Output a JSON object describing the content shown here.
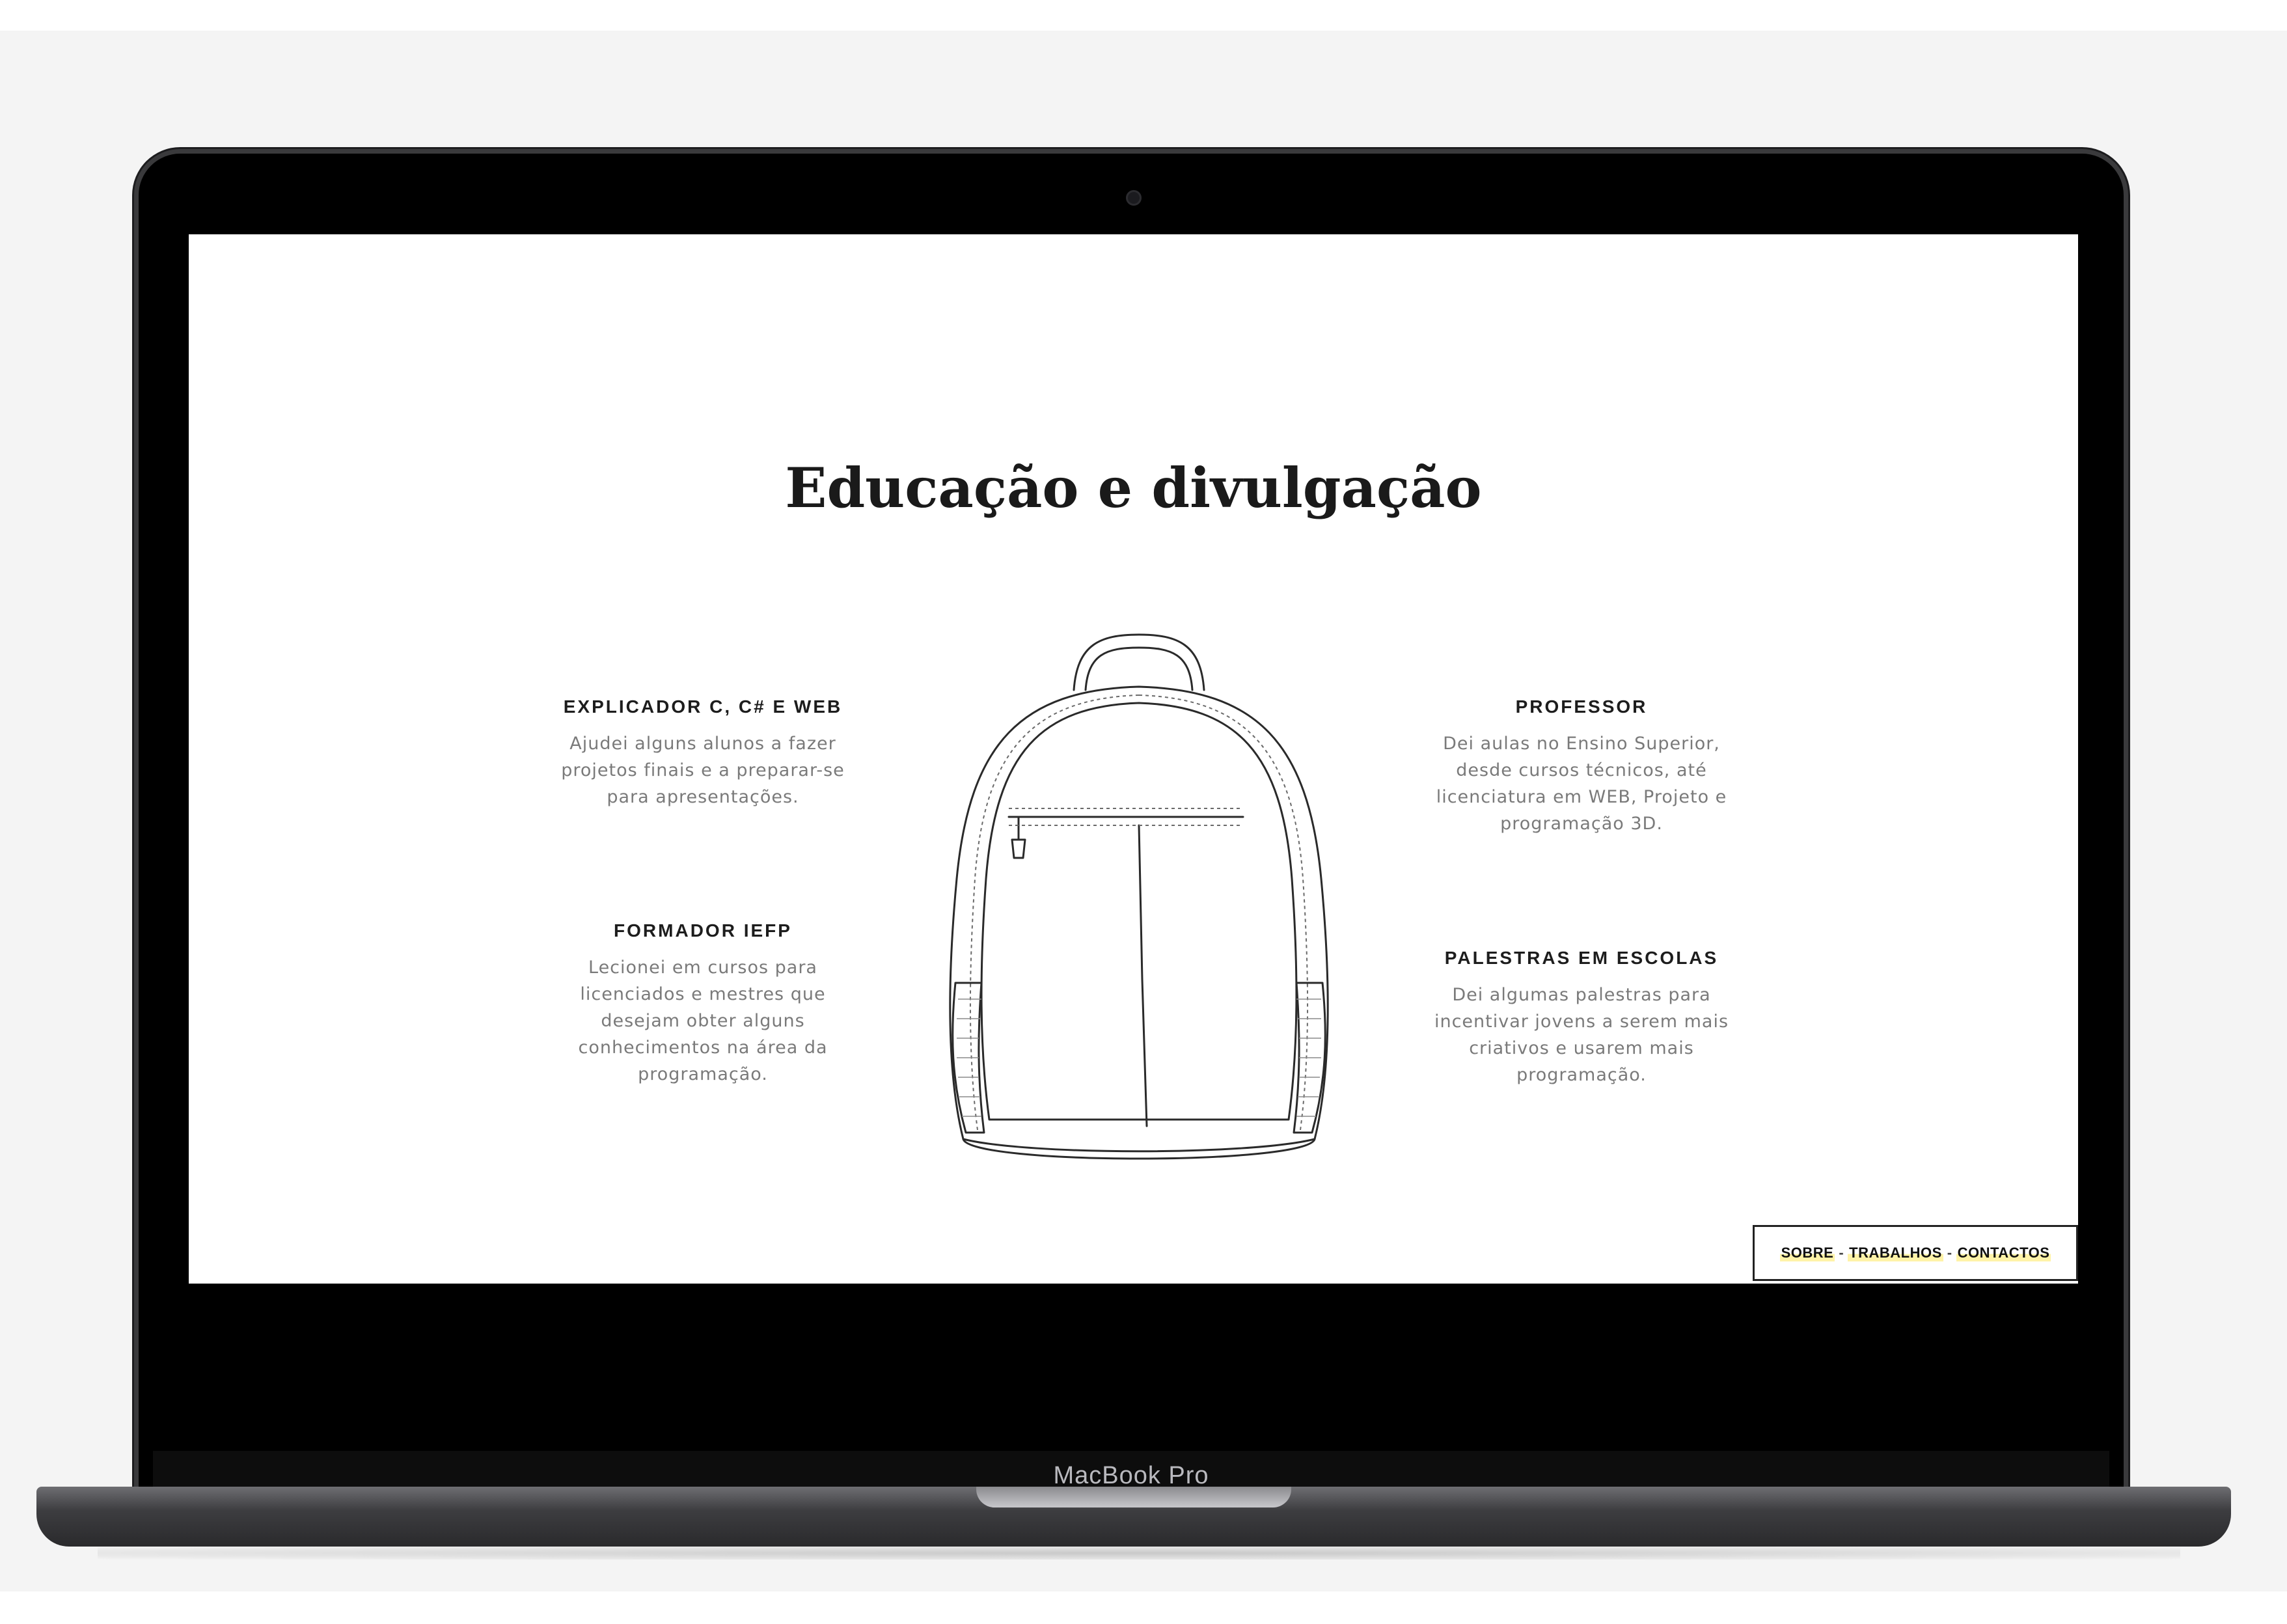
{
  "device": {
    "brand_label": "MacBook Pro"
  },
  "page": {
    "title": "Educação e divulgação",
    "items": [
      {
        "heading": "EXPLICADOR C, C# E WEB",
        "body": "Ajudei alguns alunos a fazer projetos finais e a preparar-se para apresentações."
      },
      {
        "heading": "FORMADOR IEFP",
        "body": "Lecionei em cursos para licenciados e mestres que desejam obter alguns conhecimentos na área da programação."
      },
      {
        "heading": "PROFESSOR",
        "body": "Dei aulas no Ensino Superior, desde cursos técnicos, até licenciatura em WEB, Projeto e programação 3D."
      },
      {
        "heading": "PALESTRAS EM ESCOLAS",
        "body": "Dei algumas palestras para incentivar jovens a serem mais criativos e usarem mais programação."
      }
    ]
  },
  "nav": {
    "links": [
      "SOBRE",
      "TRABALHOS",
      "CONTACTOS"
    ],
    "separator": "-"
  },
  "colors": {
    "highlight": "#fff3a8",
    "text_dark": "#1a1a1a",
    "text_muted": "#7a7a7a"
  }
}
